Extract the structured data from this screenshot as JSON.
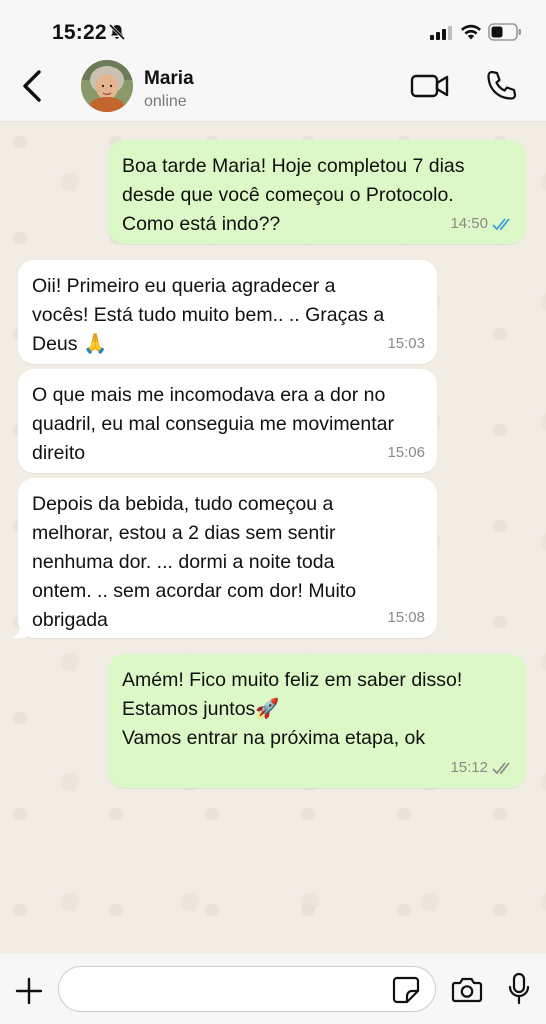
{
  "status_bar": {
    "time": "15:22"
  },
  "header": {
    "contact_name": "Maria",
    "contact_status": "online"
  },
  "messages": [
    {
      "direction": "out",
      "text": "Boa tarde Maria! Hoje completou 7 dias\ndesde que você começou o Protocolo.\nComo está indo??",
      "time": "14:50",
      "read": true
    },
    {
      "direction": "in",
      "text": "Oii! Primeiro eu queria agradecer a\nvocês! Está tudo muito bem.. .. Graças a\nDeus 🙏",
      "time": "15:03"
    },
    {
      "direction": "in",
      "text": "O que mais me incomodava era a dor no\nquadril, eu mal conseguia me movimentar\ndireito",
      "time": "15:06"
    },
    {
      "direction": "in",
      "text": "Depois da bebida, tudo começou a\nmelhorar, estou a 2 dias sem sentir\nnenhuma dor. ... dormi a noite toda\nontem. .. sem acordar com dor! Muito\nobrigada",
      "time": "15:08"
    },
    {
      "direction": "out",
      "text": "Amém! Fico muito feliz em saber disso!\nEstamos juntos🚀\nVamos entrar na próxima etapa, ok",
      "time": "15:12",
      "read": false
    }
  ],
  "input": {
    "placeholder": ""
  },
  "colors": {
    "outgoing_bubble": "#dbf8c6",
    "incoming_bubble": "#ffffff",
    "read_check": "#3a9ad9",
    "delivered_check": "#8a8a8a"
  },
  "icons": [
    "bell-slash-icon",
    "signal-icon",
    "wifi-icon",
    "battery-icon",
    "back-chevron-icon",
    "video-camera-icon",
    "phone-icon",
    "plus-icon",
    "sticker-icon",
    "camera-icon",
    "microphone-icon"
  ]
}
